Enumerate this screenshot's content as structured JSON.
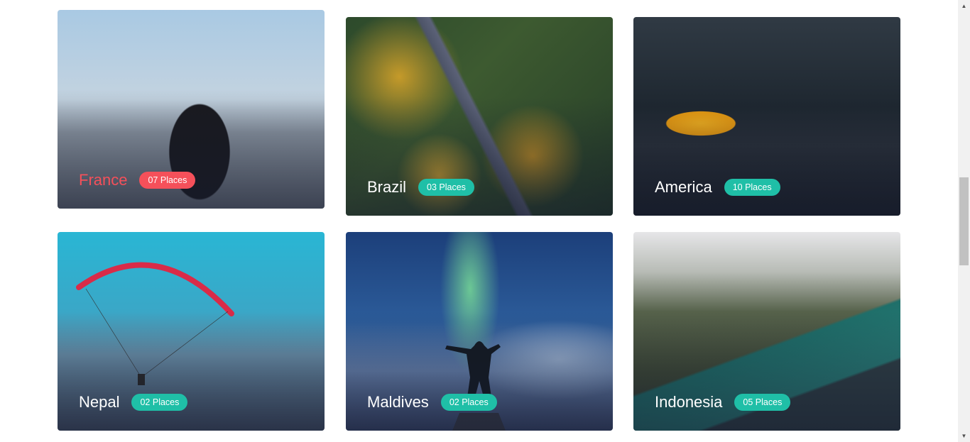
{
  "destinations": [
    {
      "name": "France",
      "places": "07 Places",
      "active": true
    },
    {
      "name": "Brazil",
      "places": "03 Places"
    },
    {
      "name": "America",
      "places": "10 Places"
    },
    {
      "name": "Nepal",
      "places": "02 Places"
    },
    {
      "name": "Maldives",
      "places": "02 Places"
    },
    {
      "name": "Indonesia",
      "places": "05 Places"
    }
  ],
  "colors": {
    "badge": "#1fbfa7",
    "active_accent": "#f5505a"
  },
  "scrollbar": {
    "up_icon": "triangle-up-icon",
    "down_icon": "triangle-down-icon"
  }
}
